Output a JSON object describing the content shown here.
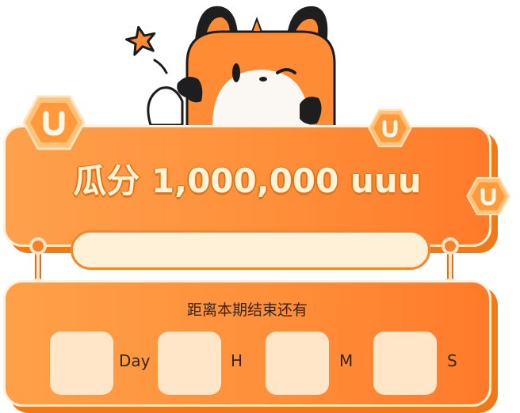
{
  "banner": {
    "title": "瓜分 1,000,000 uuu"
  },
  "countdown": {
    "heading": "距离本期结束还有",
    "units": [
      {
        "label": "Day"
      },
      {
        "label": "H"
      },
      {
        "label": "M"
      },
      {
        "label": "S"
      }
    ]
  },
  "icons": {
    "mascot": "fox-mascot-icon",
    "star": "star-icon",
    "coin": "u-coin-icon"
  },
  "colors": {
    "accent": "#ff8d38",
    "panel_light": "#fff0d8",
    "shadow": "#f07a18"
  }
}
